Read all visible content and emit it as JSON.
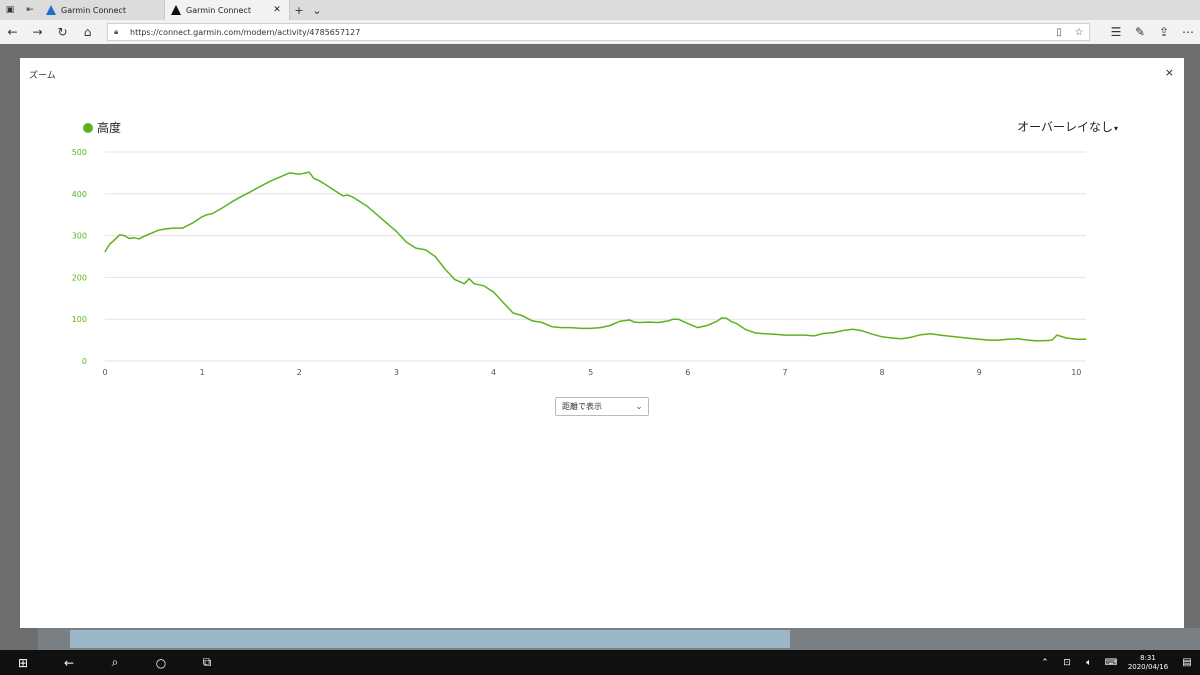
{
  "browser": {
    "tabs": [
      {
        "title": "Garmin Connect",
        "active": false
      },
      {
        "title": "Garmin Connect",
        "active": true
      }
    ],
    "url": "https://connect.garmin.com/modern/activity/4785657127"
  },
  "modal": {
    "title": "ズーム",
    "close": "×",
    "legend_label": "高度",
    "overlay_label": "オーバーレイなし",
    "overlay_caret": "▾",
    "unit_select_value": "距離で表示"
  },
  "taskbar": {
    "time": "8:31",
    "date": "2020/04/16"
  },
  "colors": {
    "series": "#5db31f",
    "axis_label": "#5db31f"
  },
  "chart_data": {
    "type": "line",
    "xlim": [
      0,
      10.1
    ],
    "ylim": [
      0,
      500
    ],
    "x_ticks": [
      0,
      1,
      2,
      3,
      4,
      5,
      6,
      7,
      8,
      9,
      10
    ],
    "y_ticks": [
      0,
      100,
      200,
      300,
      400,
      500
    ],
    "grid": true,
    "series": [
      {
        "name": "高度",
        "x": [
          0,
          0.05,
          0.1,
          0.15,
          0.2,
          0.25,
          0.3,
          0.35,
          0.4,
          0.45,
          0.5,
          0.55,
          0.6,
          0.7,
          0.8,
          0.9,
          1.0,
          1.05,
          1.1,
          1.2,
          1.3,
          1.4,
          1.5,
          1.6,
          1.7,
          1.8,
          1.9,
          2.0,
          2.05,
          2.1,
          2.15,
          2.2,
          2.25,
          2.35,
          2.45,
          2.5,
          2.55,
          2.6,
          2.7,
          2.8,
          2.9,
          3.0,
          3.1,
          3.2,
          3.3,
          3.4,
          3.5,
          3.6,
          3.7,
          3.75,
          3.8,
          3.9,
          4.0,
          4.1,
          4.2,
          4.3,
          4.4,
          4.5,
          4.6,
          4.7,
          4.8,
          4.9,
          5.0,
          5.1,
          5.2,
          5.3,
          5.4,
          5.45,
          5.5,
          5.6,
          5.7,
          5.8,
          5.85,
          5.9,
          6.0,
          6.1,
          6.2,
          6.3,
          6.35,
          6.4,
          6.45,
          6.5,
          6.6,
          6.7,
          6.8,
          6.9,
          7.0,
          7.1,
          7.2,
          7.3,
          7.4,
          7.5,
          7.6,
          7.7,
          7.8,
          7.9,
          8.0,
          8.1,
          8.2,
          8.3,
          8.4,
          8.5,
          8.6,
          8.7,
          8.8,
          8.9,
          9.0,
          9.1,
          9.2,
          9.3,
          9.4,
          9.5,
          9.6,
          9.7,
          9.75,
          9.8,
          9.9,
          10.0,
          10.1
        ],
        "y": [
          262,
          280,
          290,
          302,
          300,
          293,
          295,
          292,
          298,
          303,
          308,
          313,
          315,
          318,
          318,
          330,
          345,
          350,
          352,
          365,
          380,
          393,
          405,
          418,
          430,
          440,
          450,
          447,
          449,
          452,
          437,
          432,
          425,
          410,
          395,
          397,
          392,
          385,
          370,
          350,
          330,
          310,
          285,
          270,
          266,
          250,
          220,
          195,
          185,
          197,
          185,
          180,
          165,
          140,
          115,
          108,
          96,
          92,
          82,
          80,
          80,
          78,
          78,
          80,
          85,
          95,
          98,
          93,
          92,
          93,
          92,
          96,
          100,
          100,
          90,
          80,
          85,
          95,
          103,
          102,
          94,
          90,
          75,
          67,
          65,
          64,
          62,
          62,
          62,
          60,
          66,
          68,
          73,
          76,
          72,
          64,
          58,
          55,
          53,
          57,
          63,
          65,
          62,
          59,
          57,
          54,
          52,
          50,
          50,
          52,
          53,
          50,
          48,
          49,
          50,
          62,
          55,
          52,
          52
        ]
      }
    ]
  }
}
